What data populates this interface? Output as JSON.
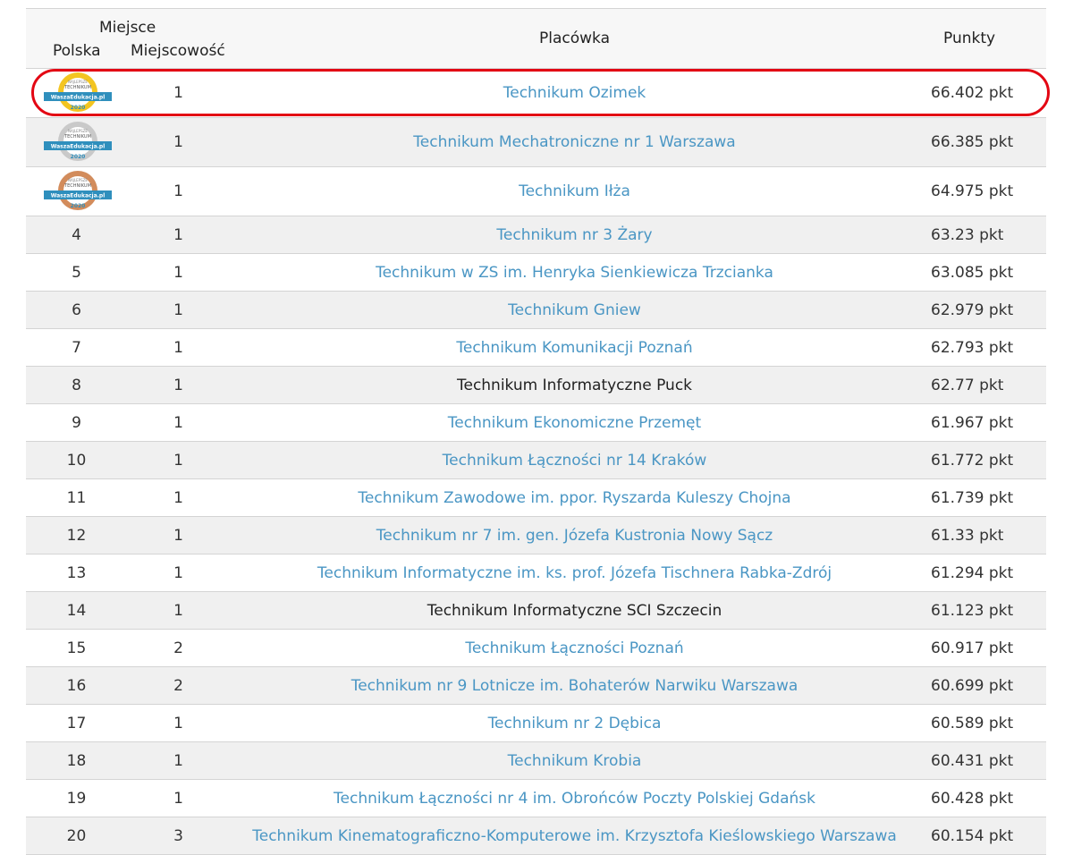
{
  "header": {
    "miejsce": "Miejsce",
    "polska": "Polska",
    "miejscowosc": "Miejscowość",
    "placowka": "Placówka",
    "punkty": "Punkty"
  },
  "badge_text": {
    "small": "NAJLEPSZE",
    "main": "TECHNIKUM",
    "brand": "WaszaEdukacja.pl",
    "year": "2020"
  },
  "colors": {
    "gold": "#f3c521",
    "silver": "#c9c9c9",
    "bronze": "#d28c5c",
    "ribbon": "#2f8fbd",
    "highlight": "#e30613",
    "link": "#4a96c4"
  },
  "rows": [
    {
      "polska": "",
      "badge": "gold",
      "miejscowosc": "1",
      "name": "Technikum Ozimek",
      "points": "66.402 pkt",
      "link": true
    },
    {
      "polska": "",
      "badge": "silver",
      "miejscowosc": "1",
      "name": "Technikum Mechatroniczne nr 1 Warszawa",
      "points": "66.385 pkt",
      "link": true
    },
    {
      "polska": "",
      "badge": "bronze",
      "miejscowosc": "1",
      "name": "Technikum Iłża",
      "points": "64.975 pkt",
      "link": true
    },
    {
      "polska": "4",
      "miejscowosc": "1",
      "name": "Technikum nr 3 Żary",
      "points": "63.23 pkt",
      "link": true
    },
    {
      "polska": "5",
      "miejscowosc": "1",
      "name": "Technikum w ZS im. Henryka Sienkiewicza Trzcianka",
      "points": "63.085 pkt",
      "link": true
    },
    {
      "polska": "6",
      "miejscowosc": "1",
      "name": "Technikum Gniew",
      "points": "62.979 pkt",
      "link": true
    },
    {
      "polska": "7",
      "miejscowosc": "1",
      "name": "Technikum Komunikacji Poznań",
      "points": "62.793 pkt",
      "link": true
    },
    {
      "polska": "8",
      "miejscowosc": "1",
      "name": "Technikum Informatyczne Puck",
      "points": "62.77 pkt",
      "link": false
    },
    {
      "polska": "9",
      "miejscowosc": "1",
      "name": "Technikum Ekonomiczne Przemęt",
      "points": "61.967 pkt",
      "link": true
    },
    {
      "polska": "10",
      "miejscowosc": "1",
      "name": "Technikum Łączności nr 14 Kraków",
      "points": "61.772 pkt",
      "link": true
    },
    {
      "polska": "11",
      "miejscowosc": "1",
      "name": "Technikum Zawodowe im. ppor. Ryszarda Kuleszy Chojna",
      "points": "61.739 pkt",
      "link": true
    },
    {
      "polska": "12",
      "miejscowosc": "1",
      "name": "Technikum nr 7 im. gen. Józefa Kustronia Nowy Sącz",
      "points": "61.33 pkt",
      "link": true
    },
    {
      "polska": "13",
      "miejscowosc": "1",
      "name": "Technikum Informatyczne im. ks. prof. Józefa Tischnera Rabka-Zdrój",
      "points": "61.294 pkt",
      "link": true
    },
    {
      "polska": "14",
      "miejscowosc": "1",
      "name": "Technikum Informatyczne SCI Szczecin",
      "points": "61.123 pkt",
      "link": false
    },
    {
      "polska": "15",
      "miejscowosc": "2",
      "name": "Technikum Łączności Poznań",
      "points": "60.917 pkt",
      "link": true
    },
    {
      "polska": "16",
      "miejscowosc": "2",
      "name": "Technikum nr 9 Lotnicze im. Bohaterów Narwiku Warszawa",
      "points": "60.699 pkt",
      "link": true
    },
    {
      "polska": "17",
      "miejscowosc": "1",
      "name": "Technikum nr 2 Dębica",
      "points": "60.589 pkt",
      "link": true
    },
    {
      "polska": "18",
      "miejscowosc": "1",
      "name": "Technikum Krobia",
      "points": "60.431 pkt",
      "link": true
    },
    {
      "polska": "19",
      "miejscowosc": "1",
      "name": "Technikum Łączności nr 4 im. Obrońców Poczty Polskiej Gdańsk",
      "points": "60.428 pkt",
      "link": true
    },
    {
      "polska": "20",
      "miejscowosc": "3",
      "name": "Technikum Kinematograficzno-Komputerowe im. Krzysztofa Kieślowskiego Warszawa",
      "points": "60.154 pkt",
      "link": true
    }
  ]
}
